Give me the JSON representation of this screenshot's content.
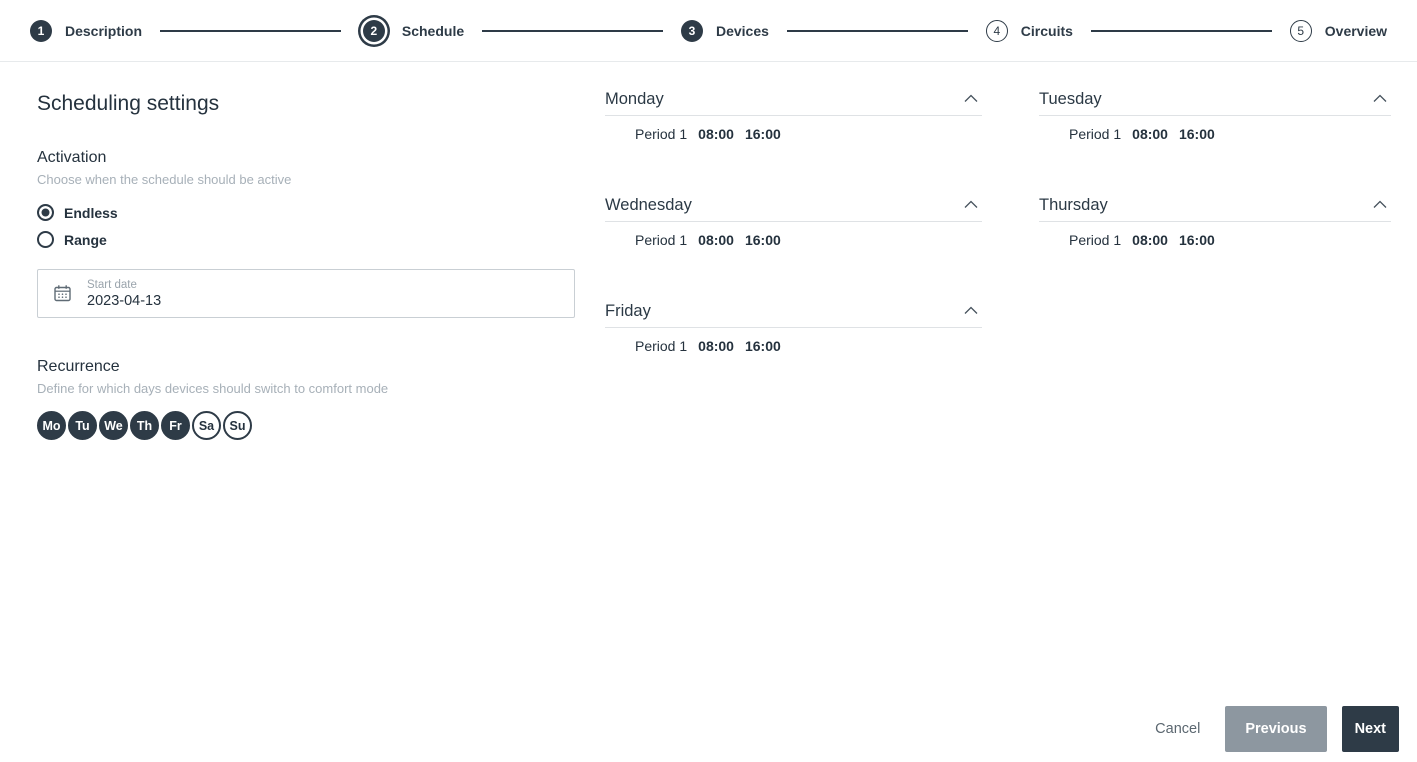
{
  "stepper": {
    "steps": [
      {
        "number": "1",
        "label": "Description",
        "state": "filled"
      },
      {
        "number": "2",
        "label": "Schedule",
        "state": "current"
      },
      {
        "number": "3",
        "label": "Devices",
        "state": "filled"
      },
      {
        "number": "4",
        "label": "Circuits",
        "state": "upcoming"
      },
      {
        "number": "5",
        "label": "Overview",
        "state": "upcoming"
      }
    ]
  },
  "settings": {
    "title": "Scheduling settings",
    "activation": {
      "heading": "Activation",
      "description": "Choose when the schedule should be active",
      "options": [
        {
          "label": "Endless",
          "selected": true
        },
        {
          "label": "Range",
          "selected": false
        }
      ]
    },
    "start_date": {
      "label": "Start date",
      "value": "2023-04-13"
    },
    "recurrence": {
      "heading": "Recurrence",
      "description": "Define for which days devices should switch to comfort mode",
      "days": [
        {
          "label": "Mo",
          "selected": true
        },
        {
          "label": "Tu",
          "selected": true
        },
        {
          "label": "We",
          "selected": true
        },
        {
          "label": "Th",
          "selected": true
        },
        {
          "label": "Fr",
          "selected": true
        },
        {
          "label": "Sa",
          "selected": false
        },
        {
          "label": "Su",
          "selected": false
        }
      ]
    }
  },
  "schedule_days": [
    {
      "name": "Monday",
      "period": {
        "label": "Period 1",
        "start": "08:00",
        "end": "16:00"
      }
    },
    {
      "name": "Tuesday",
      "period": {
        "label": "Period 1",
        "start": "08:00",
        "end": "16:00"
      }
    },
    {
      "name": "Wednesday",
      "period": {
        "label": "Period 1",
        "start": "08:00",
        "end": "16:00"
      }
    },
    {
      "name": "Thursday",
      "period": {
        "label": "Period 1",
        "start": "08:00",
        "end": "16:00"
      }
    },
    {
      "name": "Friday",
      "period": {
        "label": "Period 1",
        "start": "08:00",
        "end": "16:00"
      }
    }
  ],
  "footer": {
    "cancel": "Cancel",
    "previous": "Previous",
    "next": "Next"
  },
  "icons": {
    "calendar": "calendar-icon",
    "chevron_up": "chevron-up-icon"
  },
  "colors": {
    "dark": "#2e3b47",
    "gray_button": "#8d97a0",
    "muted_text": "#a7b0b8",
    "divider": "#dfe2e5"
  }
}
